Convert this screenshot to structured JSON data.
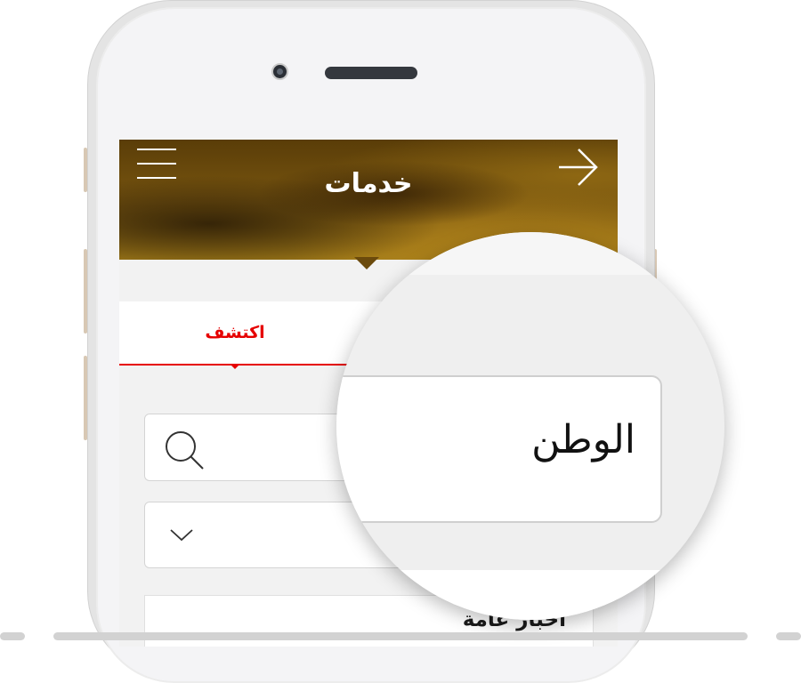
{
  "header": {
    "title": "خدمات"
  },
  "tabs": [
    {
      "label": "اكتشف",
      "active": true
    }
  ],
  "search": {
    "magnified_value": "الوطن"
  },
  "news": {
    "category_label": "اخبار عامة"
  },
  "colors": {
    "accent": "#e60000",
    "header_gold": "#8a6412",
    "screen_bg": "#f2f2f2"
  },
  "icons": {
    "menu": "hamburger-menu-icon",
    "back": "arrow-right-icon",
    "search": "magnifier-search-icon",
    "dropdown": "chevron-down-icon"
  }
}
